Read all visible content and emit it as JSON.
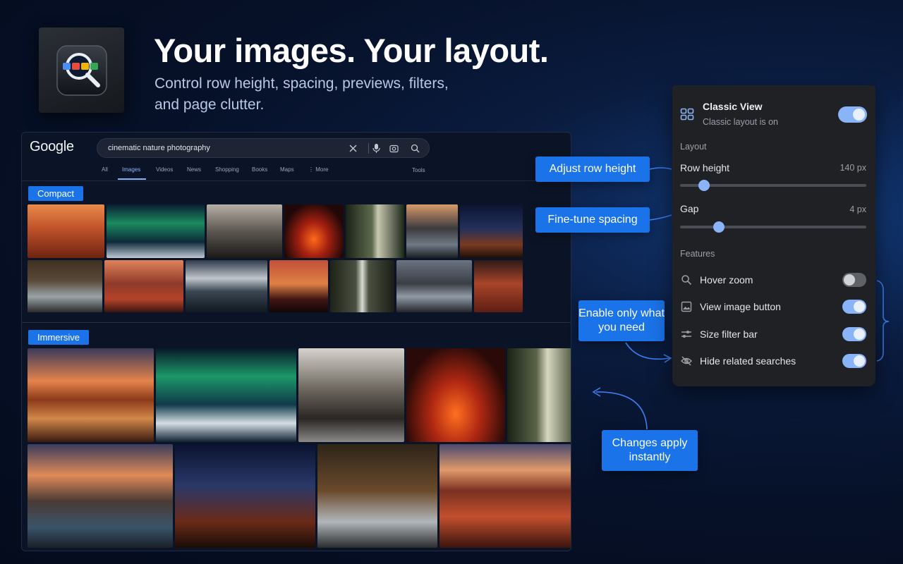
{
  "hero": {
    "title": "Your images. Your layout.",
    "subtitle": "Control row height, spacing, previews, filters, and page clutter."
  },
  "google": {
    "logo": "Google",
    "query": "cinematic nature photography",
    "tabs": [
      "All",
      "Images",
      "Videos",
      "News",
      "Shopping",
      "Books",
      "Maps",
      "⋮ More",
      "Tools"
    ],
    "active_tab": "Images",
    "compact_label": "Compact",
    "immersive_label": "Immersive"
  },
  "callouts": {
    "row_height": "Adjust row height",
    "spacing": "Fine-tune spacing",
    "enable_only": "Enable only what you need",
    "changes_apply": "Changes apply instantly"
  },
  "settings": {
    "title": "Classic View",
    "subtitle": "Classic layout is on",
    "classic_enabled": true,
    "layout_heading": "Layout",
    "row_height_label": "Row height",
    "row_height_value": "140 px",
    "row_height_fraction": 0.13,
    "gap_label": "Gap",
    "gap_value": "4 px",
    "gap_fraction": 0.21,
    "features_heading": "Features",
    "features": [
      {
        "label": "Hover zoom",
        "icon": "search-icon",
        "enabled": false
      },
      {
        "label": "View image button",
        "icon": "image-icon",
        "enabled": true
      },
      {
        "label": "Size filter bar",
        "icon": "sliders-icon",
        "enabled": true
      },
      {
        "label": "Hide related searches",
        "icon": "eye-off-icon",
        "enabled": true
      }
    ]
  },
  "colors": {
    "accent": "#1a73e8",
    "toggle_on": "#8ab4f8",
    "panel_bg": "#1f2125",
    "page_bg": "#061027"
  }
}
